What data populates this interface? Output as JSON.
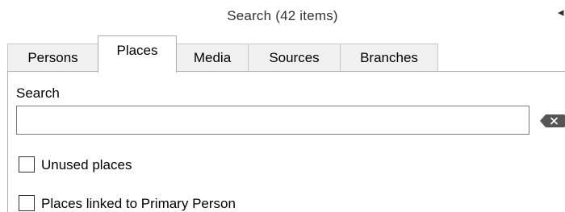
{
  "window": {
    "title": "Search (42 items)",
    "marker": "◂"
  },
  "tabs": [
    {
      "label": "Persons",
      "active": false
    },
    {
      "label": "Places",
      "active": true
    },
    {
      "label": "Media",
      "active": false
    },
    {
      "label": "Sources",
      "active": false
    },
    {
      "label": "Branches",
      "active": false
    }
  ],
  "search": {
    "label": "Search",
    "value": "",
    "placeholder": "",
    "clear_icon": "backspace-clear-icon"
  },
  "filters": {
    "unused_places": {
      "label": "Unused places",
      "checked": false
    },
    "primary_person": {
      "label": "Places linked to Primary Person",
      "checked": false
    }
  },
  "colors": {
    "tab_inactive_bg": "#f0f0f0",
    "border": "#adadad",
    "clear_icon": "#555555"
  }
}
